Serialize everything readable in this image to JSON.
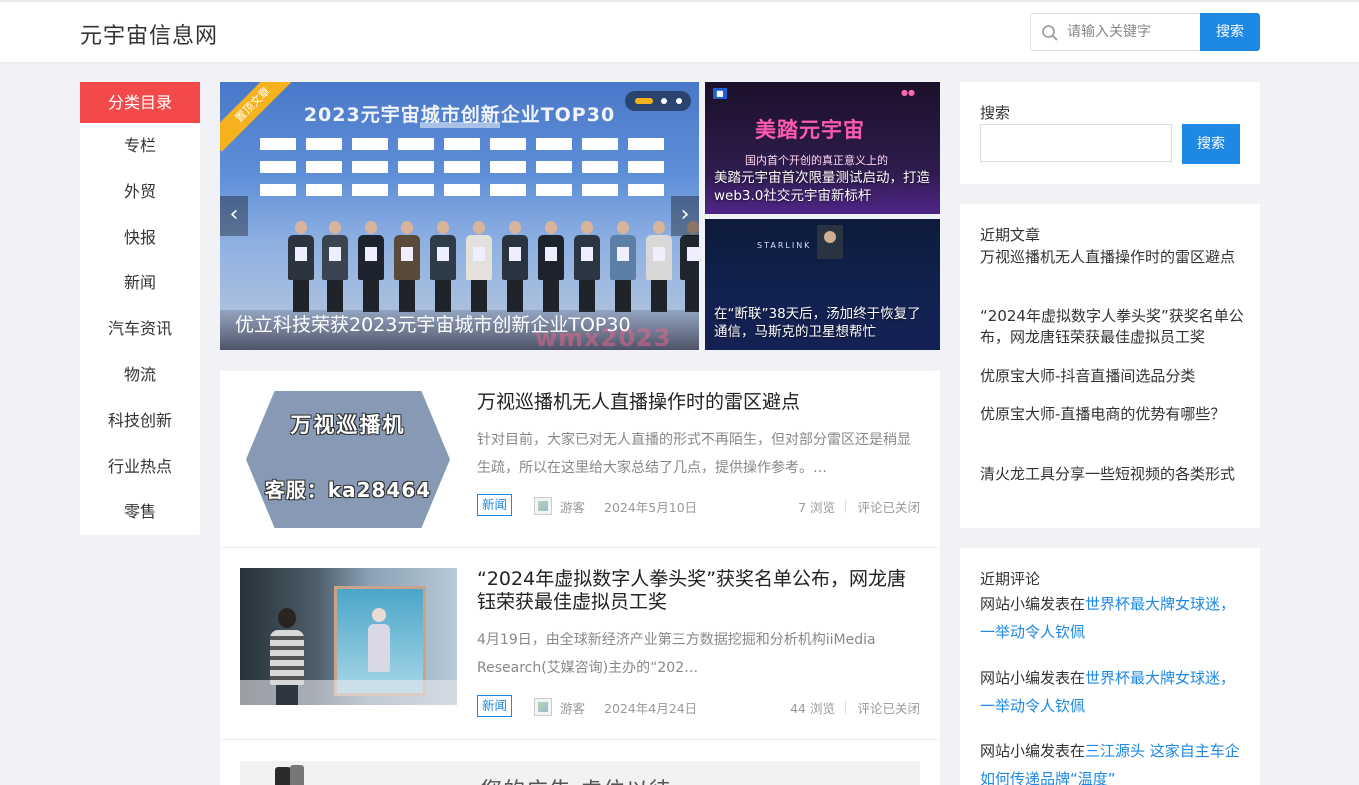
{
  "header": {
    "site_title": "元宇宙信息网",
    "search_placeholder": "请输入关键字",
    "search_button": "搜索"
  },
  "category_nav": {
    "heading": "分类目录",
    "items": [
      {
        "label": "专栏"
      },
      {
        "label": "外贸"
      },
      {
        "label": "快报"
      },
      {
        "label": "新闻"
      },
      {
        "label": "汽车资讯"
      },
      {
        "label": "物流"
      },
      {
        "label": "科技创新"
      },
      {
        "label": "行业热点"
      },
      {
        "label": "零售"
      }
    ]
  },
  "slider": {
    "ribbon": "置顶文章",
    "banner_text": "2023元宇宙城市创新企业TOP30",
    "caption": "优立科技荣获2023元宇宙城市创新企业TOP30",
    "watermark": "wmx2023",
    "prev_arrow": "‹",
    "next_arrow": "›",
    "active_dot": 1,
    "dot_count": 3
  },
  "side_thumbs": [
    {
      "image_title": "美踏元宇宙",
      "image_subtitle": "国内首个开创的真正意义上的",
      "caption": "美踏元宇宙首次限量测试启动，打造web3.0社交元宇宙新标杆"
    },
    {
      "image_label": "STARLINK",
      "caption": "在“断联”38天后，汤加终于恢复了通信，马斯克的卫星想帮忙"
    }
  ],
  "posts": [
    {
      "title": "万视巡播机无人直播操作时的雷区避点",
      "excerpt": "针对目前，大家已对无人直播的形式不再陌生，但对部分雷区还是稍显生疏，所以在这里给大家总结了几点，提供操作参考。…",
      "image_line1": "万视巡播机",
      "image_line2": "客服：ka28464",
      "category": "新闻",
      "author": "游客",
      "date": "2024年5月10日",
      "views": "7 浏览",
      "comments": "评论已关闭"
    },
    {
      "title": "“2024年虚拟数字人拳头奖”获奖名单公布，网龙唐钰荣获最佳虚拟员工奖",
      "excerpt": "4月19日，由全球新经济产业第三方数据挖掘和分析机构iiMedia Research(艾媒咨询)主办的“202…",
      "category": "新闻",
      "author": "游客",
      "date": "2024年4月24日",
      "views": "44 浏览",
      "comments": "评论已关闭"
    }
  ],
  "ad": {
    "text": "您的广告 虚位以待"
  },
  "sidebar": {
    "search": {
      "title": "搜索",
      "button": "搜索",
      "value": ""
    },
    "recent_posts": {
      "title": "近期文章",
      "items": [
        "万视巡播机无人直播操作时的雷区避点",
        "“2024年虚拟数字人拳头奖”获奖名单公布，网龙唐钰荣获最佳虚拟员工奖",
        "优原宝大师-抖音直播间选品分类",
        "优原宝大师-直播电商的优势有哪些？",
        "清火龙工具分享一些短视频的各类形式"
      ]
    },
    "recent_comments": {
      "title": "近期评论",
      "items": [
        {
          "author": "网站小编",
          "connector": "发表在",
          "post": "世界杯最大牌女球迷，一举动令人钦佩"
        },
        {
          "author": "网站小编",
          "connector": "发表在",
          "post": "世界杯最大牌女球迷，一举动令人钦佩"
        },
        {
          "author": "网站小编",
          "connector": "发表在",
          "post": "三江源头 这家自主车企如何传递品牌“温度”"
        }
      ]
    }
  },
  "colors": {
    "accent_blue": "#1e88e5",
    "category_red": "#f24a4a",
    "ribbon_yellow": "#f5b21c",
    "page_bg": "#f0f2f5"
  }
}
